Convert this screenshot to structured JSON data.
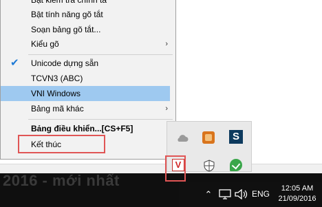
{
  "menu": {
    "items": [
      {
        "label": "Bật kiểm tra chính tả",
        "partial": true
      },
      {
        "label": "Bật tính năng gõ tắt"
      },
      {
        "label": "Soạn bảng gõ tắt..."
      },
      {
        "label": "Kiểu gõ",
        "submenu": true
      },
      {
        "label": "Unicode dựng sẵn",
        "checked": true
      },
      {
        "label": "TCVN3 (ABC)"
      },
      {
        "label": "VNI Windows",
        "highlighted": true
      },
      {
        "label": "Bảng mã khác",
        "submenu": true
      },
      {
        "label": "Bảng điều khiển...[CS+F5]",
        "bold": true
      },
      {
        "label": "Kết thúc"
      }
    ],
    "submenu_arrow": "›",
    "check_mark": "✔"
  },
  "tray": {
    "icons": [
      "cloud-icon",
      "photo-app-icon",
      "s-app-icon",
      "vietkey-icon",
      "shield-icon",
      "green-app-icon"
    ],
    "vietkey_letter": "V",
    "s_letter": "S"
  },
  "taskbar": {
    "language": "ENG",
    "time": "12:05 AM",
    "date": "21/09/2016",
    "up_arrow": "⌃"
  },
  "desktop": {
    "text": "2016 - mới nhất"
  },
  "colors": {
    "highlight": "#9ec9f0",
    "callout": "#e05555",
    "check": "#1e7ad6"
  }
}
